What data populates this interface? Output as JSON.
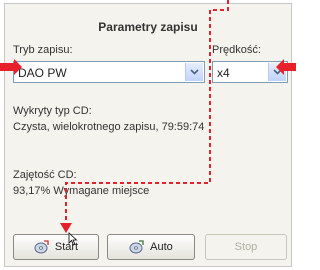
{
  "dialog": {
    "title": "Parametry zapisu",
    "mode": {
      "label": "Tryb zapisu:",
      "value": "DAO PW"
    },
    "speed": {
      "label": "Prędkość:",
      "value": "x4"
    },
    "detected": {
      "label": "Wykryty typ CD:",
      "value": "Czysta, wielokrotnego zapisu, 79:59:74"
    },
    "usage": {
      "label": "Zajętość CD:",
      "value": "93,17% Wymagane miejsce"
    },
    "buttons": {
      "start": "Start",
      "auto": "Auto",
      "stop": "Stop"
    }
  },
  "colors": {
    "annotation": "#e8202a",
    "accent": "#7f9db9"
  }
}
